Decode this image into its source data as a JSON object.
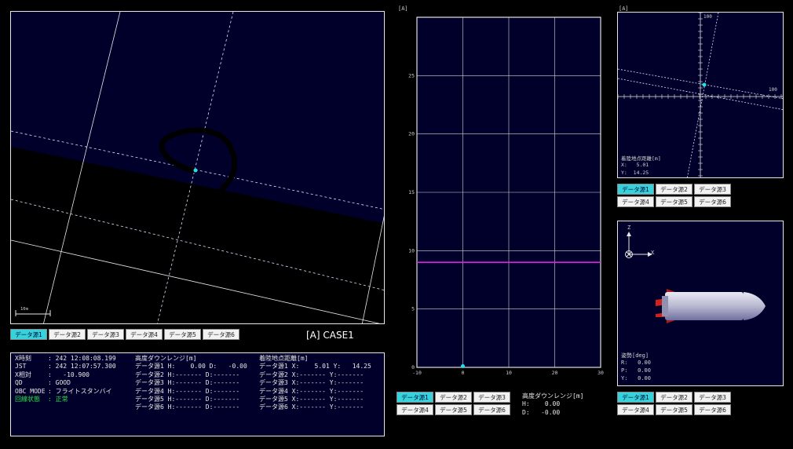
{
  "map_panel": {
    "scale_label": "10m",
    "tabs": [
      "データ源1",
      "データ源2",
      "データ源3",
      "データ源4",
      "データ源5",
      "データ源6"
    ],
    "active_tab": 0
  },
  "case_label": "[A] CASE1",
  "info": {
    "status": [
      {
        "label": "X時刻",
        "value": ": 242 12:08:08.199"
      },
      {
        "label": "JST",
        "value": ": 242 12:07:57.300"
      },
      {
        "label": "X相対",
        "value": ":   -10.900"
      },
      {
        "label": "QD",
        "value": ": GOOD"
      },
      {
        "label": "OBC MODE",
        "value": ": フライトスタンバイ"
      }
    ],
    "link_status_label": "回線状態",
    "link_status_value": ": 正常",
    "altitude_title": "高度ダウンレンジ[m]",
    "altitude_rows": [
      "データ源1 H:    0.00 D:   -0.00",
      "データ源2 H:------- D:-------",
      "データ源3 H:------- D:-------",
      "データ源4 H:------- D:-------",
      "データ源5 H:------- D:-------",
      "データ源6 H:------- D:-------"
    ],
    "landing_title": "着陸地点距離[m]",
    "landing_rows": [
      "データ源1 X:    5.01 Y:   14.25",
      "データ源2 X:------- Y:-------",
      "データ源3 X:------- Y:-------",
      "データ源4 X:------- Y:-------",
      "データ源5 X:------- Y:-------",
      "データ源6 X:------- Y:-------"
    ]
  },
  "altitude_chart": {
    "header": "[A]",
    "tabs": [
      "データ源1",
      "データ源2",
      "データ源3",
      "データ源4",
      "データ源5",
      "データ源6"
    ],
    "active_tab": 0,
    "readout_title": "高度ダウンレンジ[m]",
    "readout_h": "H:    0.00",
    "readout_d": "D:   -0.00"
  },
  "chart_data": {
    "type": "line",
    "xlim": [
      -10,
      30
    ],
    "ylim": [
      0,
      30
    ],
    "xticks": [
      "-10",
      "0",
      "10",
      "20",
      "30"
    ],
    "yticks": [
      "0",
      "5",
      "10",
      "15",
      "20",
      "25"
    ],
    "reference_line": {
      "y": 9,
      "color": "#e020e0"
    },
    "points": [
      {
        "x": 0,
        "y": 0
      }
    ],
    "grid": true
  },
  "landing_panel": {
    "header": "[A]",
    "axis_label_top": "100",
    "axis_label_right": "100",
    "title": "着陸地点距離[m]",
    "x_line": "X:   5.01",
    "y_line": "Y:  14.25",
    "tabs": [
      "データ源1",
      "データ源2",
      "データ源3",
      "データ源4",
      "データ源5",
      "データ源6"
    ],
    "active_tab": 0
  },
  "attitude_panel": {
    "axis_z": "Z",
    "axis_x": "X",
    "title": "姿勢[deg]",
    "r_line": "R:   0.00",
    "p_line": "P:   0.00",
    "y_line": "Y:   0.00",
    "tabs": [
      "データ源1",
      "データ源2",
      "データ源3",
      "データ源4",
      "データ源5",
      "データ源6"
    ],
    "active_tab": 0
  },
  "colors": {
    "accent": "#36d3dc",
    "panel_bg": "#00002a",
    "marker": "#22e0e8",
    "ref_line": "#e020e0"
  }
}
